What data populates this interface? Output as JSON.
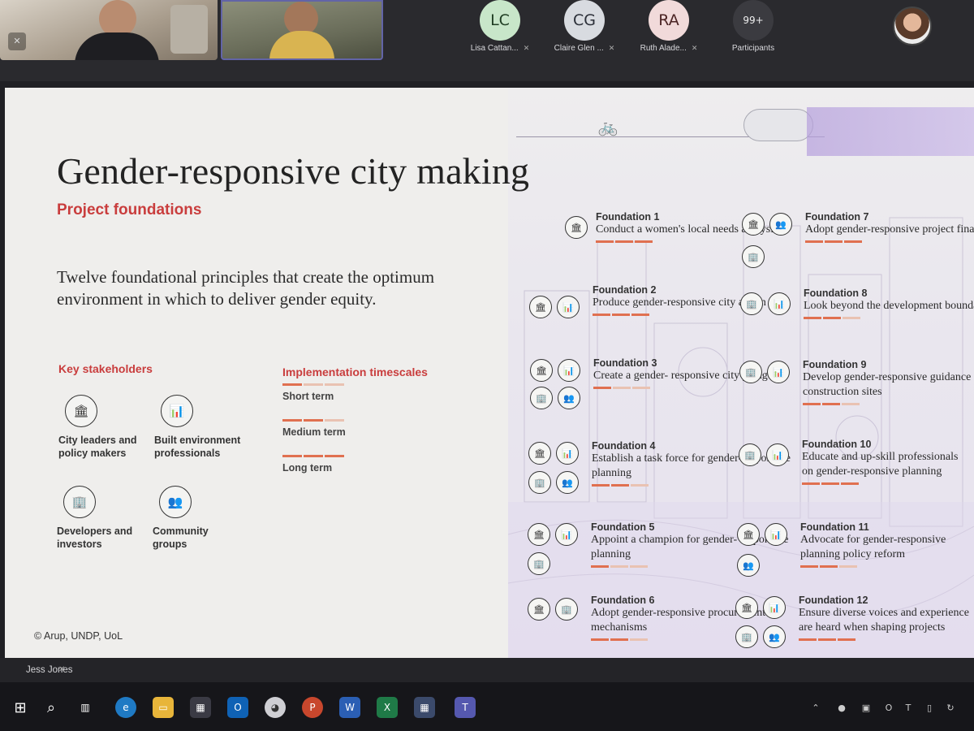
{
  "meeting": {
    "participants": [
      {
        "initials": "LC",
        "name": "Lisa Cattan..."
      },
      {
        "initials": "CG",
        "name": "Claire Glen ..."
      },
      {
        "initials": "RA",
        "name": "Ruth Alade..."
      }
    ],
    "more": {
      "count": "99+",
      "label": "Participants"
    },
    "presenter_name": "Jess Jones",
    "mic_off_icon": "mic-off-icon"
  },
  "slide": {
    "title": "Gender-responsive city making",
    "subtitle": "Project foundations",
    "intro": "Twelve foundational principles that create the optimum environment in which to deliver gender equity.",
    "stakeholders_heading": "Key stakeholders",
    "stakeholders": [
      {
        "label": "City leaders and policy makers",
        "icon": "columns-icon"
      },
      {
        "label": "Built environment professionals",
        "icon": "chart-icon"
      },
      {
        "label": "Developers and investors",
        "icon": "building-icon"
      },
      {
        "label": "Community groups",
        "icon": "people-icon"
      }
    ],
    "timescales_heading": "Implementation timescales",
    "timescales": [
      {
        "label": "Short term",
        "level": 1
      },
      {
        "label": "Medium term",
        "level": 2
      },
      {
        "label": "Long term",
        "level": 3
      }
    ],
    "copyright": "© Arup, UNDP, UoL",
    "foundations": [
      {
        "title": "Foundation 1",
        "desc": "Conduct a women's local needs analysis",
        "level": 3
      },
      {
        "title": "Foundation 2",
        "desc": "Produce gender-responsive city action plan",
        "level": 3
      },
      {
        "title": "Foundation 3",
        "desc": "Create a gender- responsive city pledge",
        "level": 1
      },
      {
        "title": "Foundation 4",
        "desc": "Establish a task force for gender-responsive planning",
        "level": 2
      },
      {
        "title": "Foundation 5",
        "desc": "Appoint a champion for gender- responsive planning",
        "level": 1
      },
      {
        "title": "Foundation 6",
        "desc": "Adopt gender-responsive procurement mechanisms",
        "level": 2
      },
      {
        "title": "Foundation 7",
        "desc": "Adopt gender-responsive project financing",
        "level": 3
      },
      {
        "title": "Foundation 8",
        "desc": "Look beyond the development boundary",
        "level": 2
      },
      {
        "title": "Foundation 9",
        "desc": "Develop gender-responsive guidance for construction sites",
        "level": 2
      },
      {
        "title": "Foundation 10",
        "desc": "Educate and up-skill professionals on gender-responsive planning",
        "level": 3
      },
      {
        "title": "Foundation 11",
        "desc": "Advocate for gender-responsive planning policy reform",
        "level": 2
      },
      {
        "title": "Foundation 12",
        "desc": "Ensure diverse voices and experience are heard when shaping projects",
        "level": 3
      }
    ]
  },
  "colors": {
    "accent_red": "#c93d3d",
    "bar_orange": "#e07050",
    "teams_purple": "#6264a7"
  },
  "taskbar": {
    "icons": [
      "windows-start-icon",
      "search-icon",
      "task-view-icon",
      "edge-icon",
      "file-explorer-icon",
      "store-icon",
      "outlook-icon",
      "paint-icon",
      "powerpoint-icon",
      "word-icon",
      "excel-icon",
      "calculator-icon",
      "teams-icon"
    ]
  }
}
